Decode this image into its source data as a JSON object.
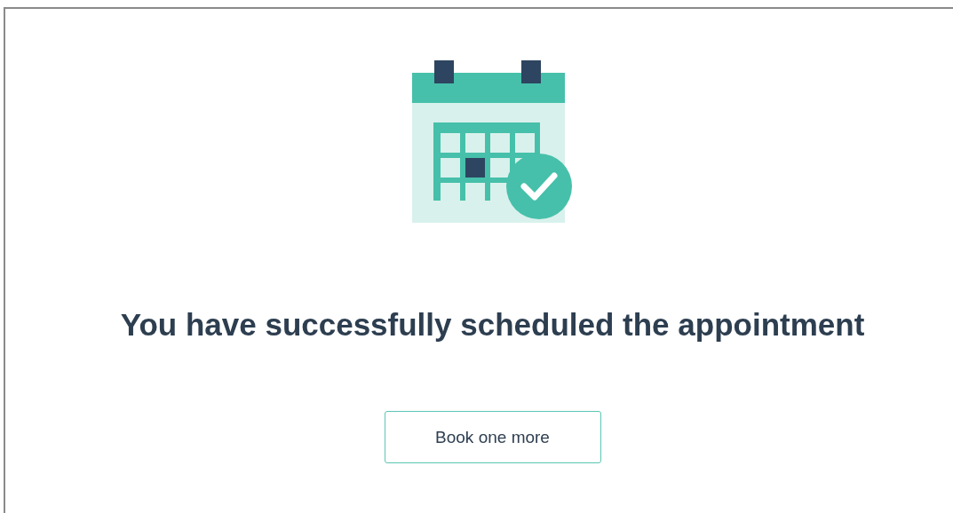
{
  "confirmation": {
    "title": "You have successfully scheduled the appointment",
    "button": {
      "label": "Book one more"
    }
  }
}
